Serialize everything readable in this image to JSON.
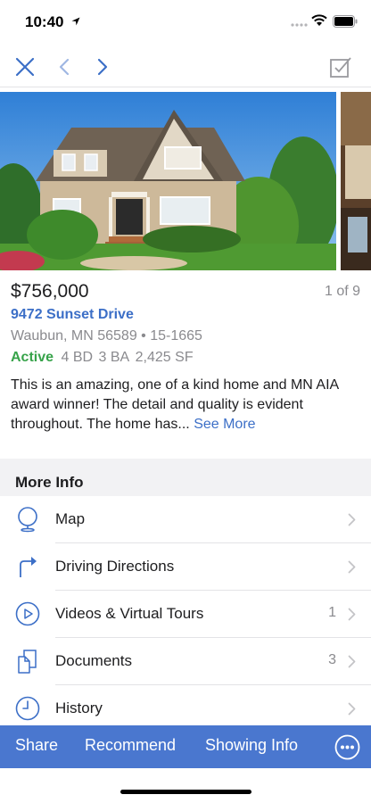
{
  "status_bar": {
    "time": "10:40"
  },
  "navbar": {
    "close_icon": "close-icon",
    "prev_icon": "chevron-left-icon",
    "next_icon": "chevron-right-icon",
    "select_icon": "checkbox-icon"
  },
  "listing": {
    "price": "$756,000",
    "photo_counter": "1 of 9",
    "address": "9472 Sunset Drive",
    "city_line": "Waubun, MN 56589 • 15-1665",
    "status": "Active",
    "beds": "4 BD",
    "baths": "3 BA",
    "sqft": "2,425 SF",
    "description": "This is an amazing, one of a kind home and MN AIA award winner! The detail and quality is evident throughout. The home has...",
    "see_more": "See More"
  },
  "more_info": {
    "header": "More Info",
    "items": [
      {
        "label": "Map",
        "icon": "map-pin-icon",
        "count": ""
      },
      {
        "label": "Driving Directions",
        "icon": "turn-right-arrow-icon",
        "count": ""
      },
      {
        "label": "Videos & Virtual Tours",
        "icon": "play-circle-icon",
        "count": "1"
      },
      {
        "label": "Documents",
        "icon": "documents-icon",
        "count": "3"
      },
      {
        "label": "History",
        "icon": "clock-icon",
        "count": ""
      }
    ]
  },
  "action_bar": {
    "share": "Share",
    "recommend": "Recommend",
    "showing_info": "Showing Info",
    "more_icon": "more-dots-icon"
  },
  "colors": {
    "accent": "#3c6fc7",
    "action_bar": "#4a77cf",
    "active_green": "#37a34a",
    "secondary_text": "#8a8a8e"
  }
}
